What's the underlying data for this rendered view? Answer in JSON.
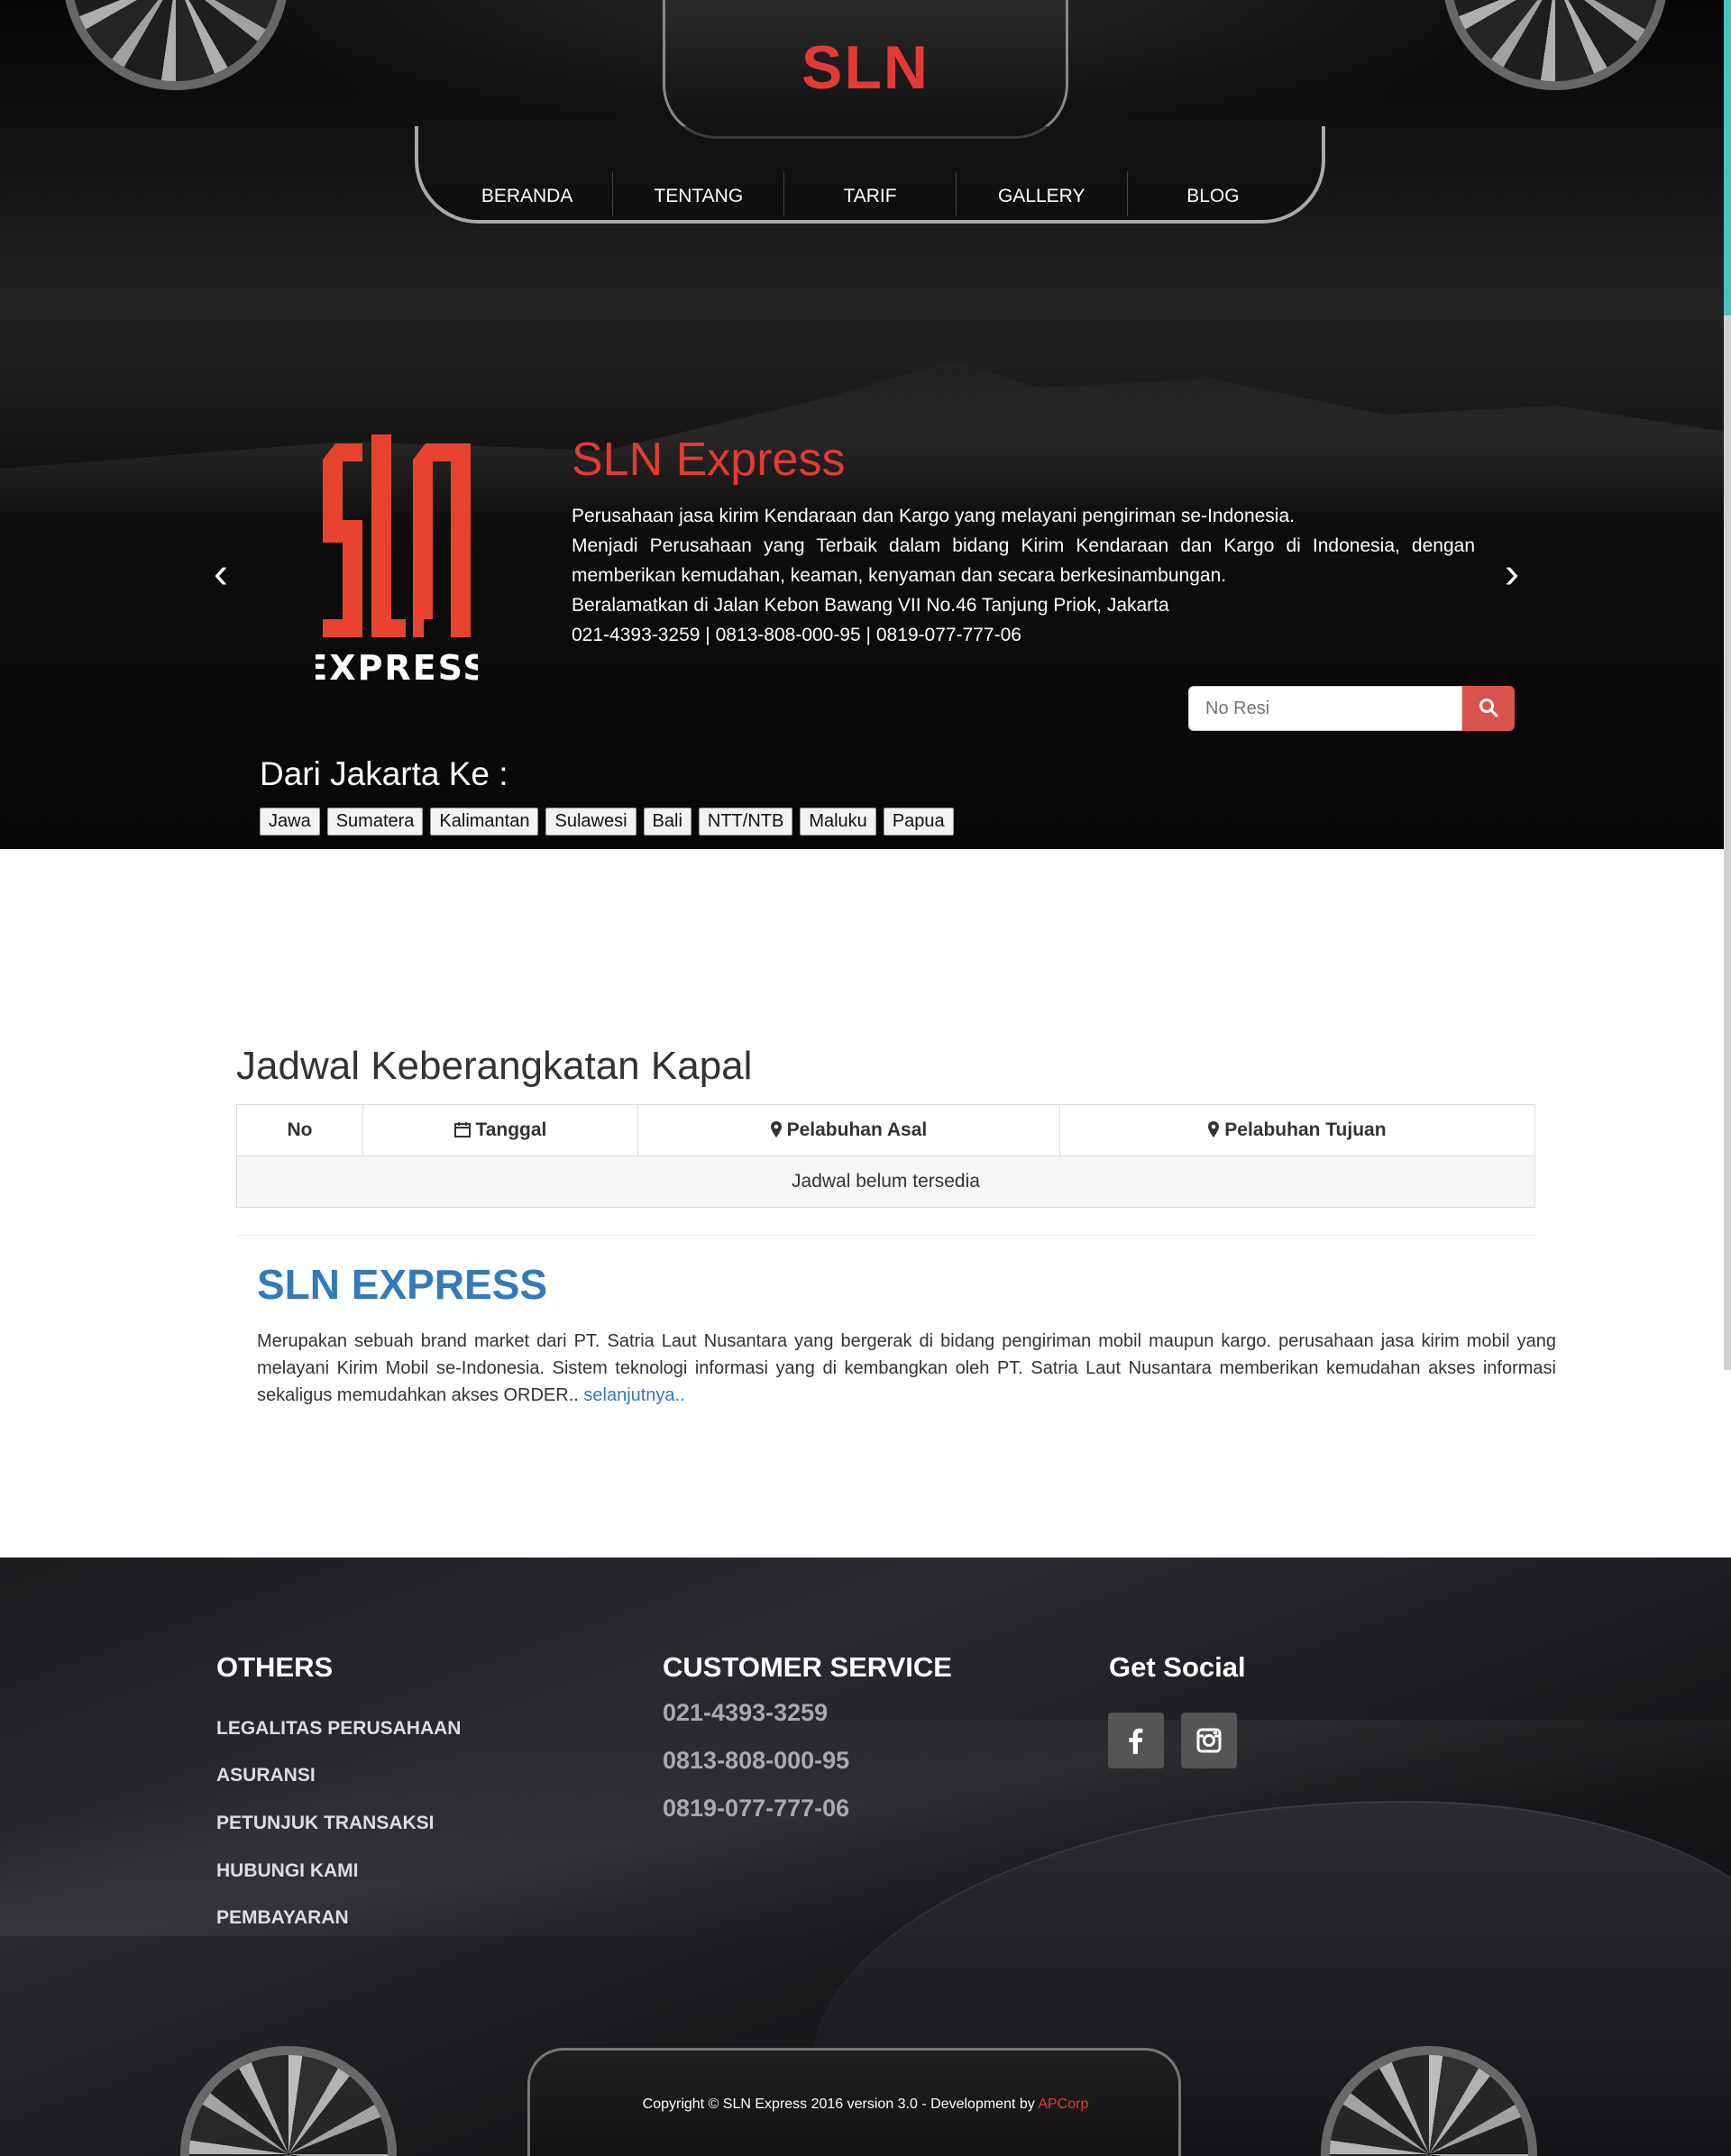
{
  "header": {
    "brand": "SLN",
    "nav": [
      "BERANDA",
      "TENTANG",
      "TARIF",
      "GALLERY",
      "BLOG"
    ]
  },
  "hero": {
    "logo_text": "EXPRESS",
    "title": "SLN Express",
    "lines": [
      "Perusahaan jasa kirim Kendaraan dan Kargo yang melayani pengiriman se-Indonesia.",
      "Menjadi Perusahaan yang Terbaik dalam bidang Kirim Kendaraan dan Kargo di Indonesia, dengan memberikan kemudahan, keaman, kenyaman dan secara berkesinambungan.",
      "Beralamatkan di Jalan Kebon Bawang VII No.46 Tanjung Priok, Jakarta",
      "021-4393-3259 | 0813-808-000-95 | 0819-077-777-06"
    ],
    "search_placeholder": "No Resi",
    "dest_title": "Dari Jakarta Ke :",
    "destinations": [
      "Jawa",
      "Sumatera",
      "Kalimantan",
      "Sulawesi",
      "Bali",
      "NTT/NTB",
      "Maluku",
      "Papua"
    ]
  },
  "schedule": {
    "title": "Jadwal Keberangkatan Kapal",
    "headers": [
      "No",
      "Tanggal",
      "Pelabuhan Asal",
      "Pelabuhan Tujuan"
    ],
    "empty": "Jadwal belum tersedia"
  },
  "about": {
    "title": "SLN EXPRESS",
    "text": "Merupakan sebuah brand market dari PT. Satria Laut Nusantara yang bergerak di bidang pengiriman mobil maupun kargo. perusahaan jasa kirim mobil yang melayani Kirim Mobil se-Indonesia. Sistem teknologi informasi yang di kembangkan oleh PT. Satria Laut Nusantara memberikan kemudahan akses informasi sekaligus memudahkan akses ORDER.. ",
    "link": "selanjutnya.."
  },
  "footer": {
    "others_title": "OTHERS",
    "others": [
      "LEGALITAS PERUSAHAAN",
      "ASURANSI",
      "PETUNJUK TRANSAKSI",
      "HUBUNGI KAMI",
      "PEMBAYARAN"
    ],
    "cs_title": "CUSTOMER SERVICE",
    "cs_phones": [
      "021-4393-3259",
      "0813-808-000-95",
      "0819-077-777-06"
    ],
    "social_title": "Get Social",
    "copyright": "Copyright © SLN Express 2016 version 3.0 - Development by ",
    "dev": "APCorp"
  }
}
